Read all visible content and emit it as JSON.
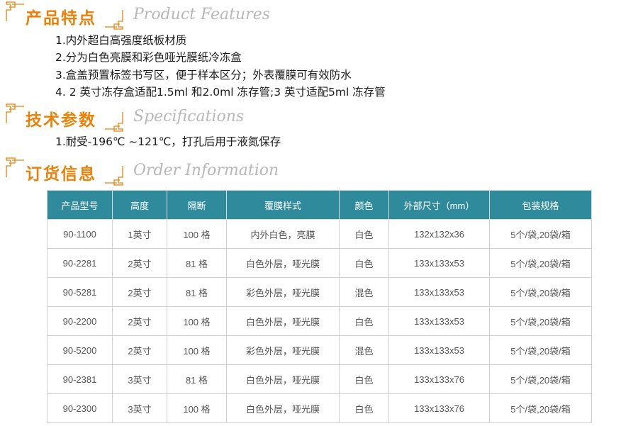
{
  "sections": [
    {
      "cn": "产品特点",
      "en": "Product Features"
    },
    {
      "cn": "技术参数",
      "en": "Specifications"
    },
    {
      "cn": "订货信息",
      "en": "Order Information"
    }
  ],
  "features": [
    "1.内外超白高强度纸板材质",
    "2.分为白色亮膜和彩色哑光膜纸冷冻盒",
    "3.盒盖预置标签书写区，便于样本区分；外表覆膜可有效防水",
    "4. 2 英寸冻存盒适配1.5ml 和2.0ml 冻存管;3 英寸适配5ml 冻存管"
  ],
  "specs": [
    "1.耐受-196℃ ~121℃，打孔后用于液氮保存"
  ],
  "table": {
    "headers": [
      "产品型号",
      "高度",
      "隔断",
      "覆膜样式",
      "颜色",
      "外部尺寸（mm）",
      "包装规格"
    ],
    "rows": [
      [
        "90-1100",
        "1英寸",
        "100 格",
        "内外白色，亮膜",
        "白色",
        "132x132x36",
        "5个/袋,20袋/箱"
      ],
      [
        "90-2281",
        "2英寸",
        "81 格",
        "白色外层，哑光膜",
        "白色",
        "133x133x53",
        "5个/袋,20袋/箱"
      ],
      [
        "90-5281",
        "2英寸",
        "81 格",
        "彩色外层，哑光膜",
        "混色",
        "133x133x53",
        "5个/袋,20袋/箱"
      ],
      [
        "90-2200",
        "2英寸",
        "100 格",
        "白色外层，哑光膜",
        "白色",
        "133x133x53",
        "5个/袋,20袋/箱"
      ],
      [
        "90-5200",
        "2英寸",
        "100 格",
        "彩色外层，哑光膜",
        "混色",
        "133x133x53",
        "5个/袋,20袋/箱"
      ],
      [
        "90-2381",
        "3英寸",
        "81 格",
        "白色外层，哑光膜",
        "白色",
        "133x133x76",
        "5个/袋,20袋/箱"
      ],
      [
        "90-2300",
        "3英寸",
        "100 格",
        "白色外层，哑光膜",
        "白色",
        "133x133x76",
        "5个/袋,20袋/箱"
      ]
    ]
  },
  "colors": {
    "accent": "#e8820a",
    "header_bg": "#2f8a9b",
    "subtitle": "#b8b8b8"
  }
}
